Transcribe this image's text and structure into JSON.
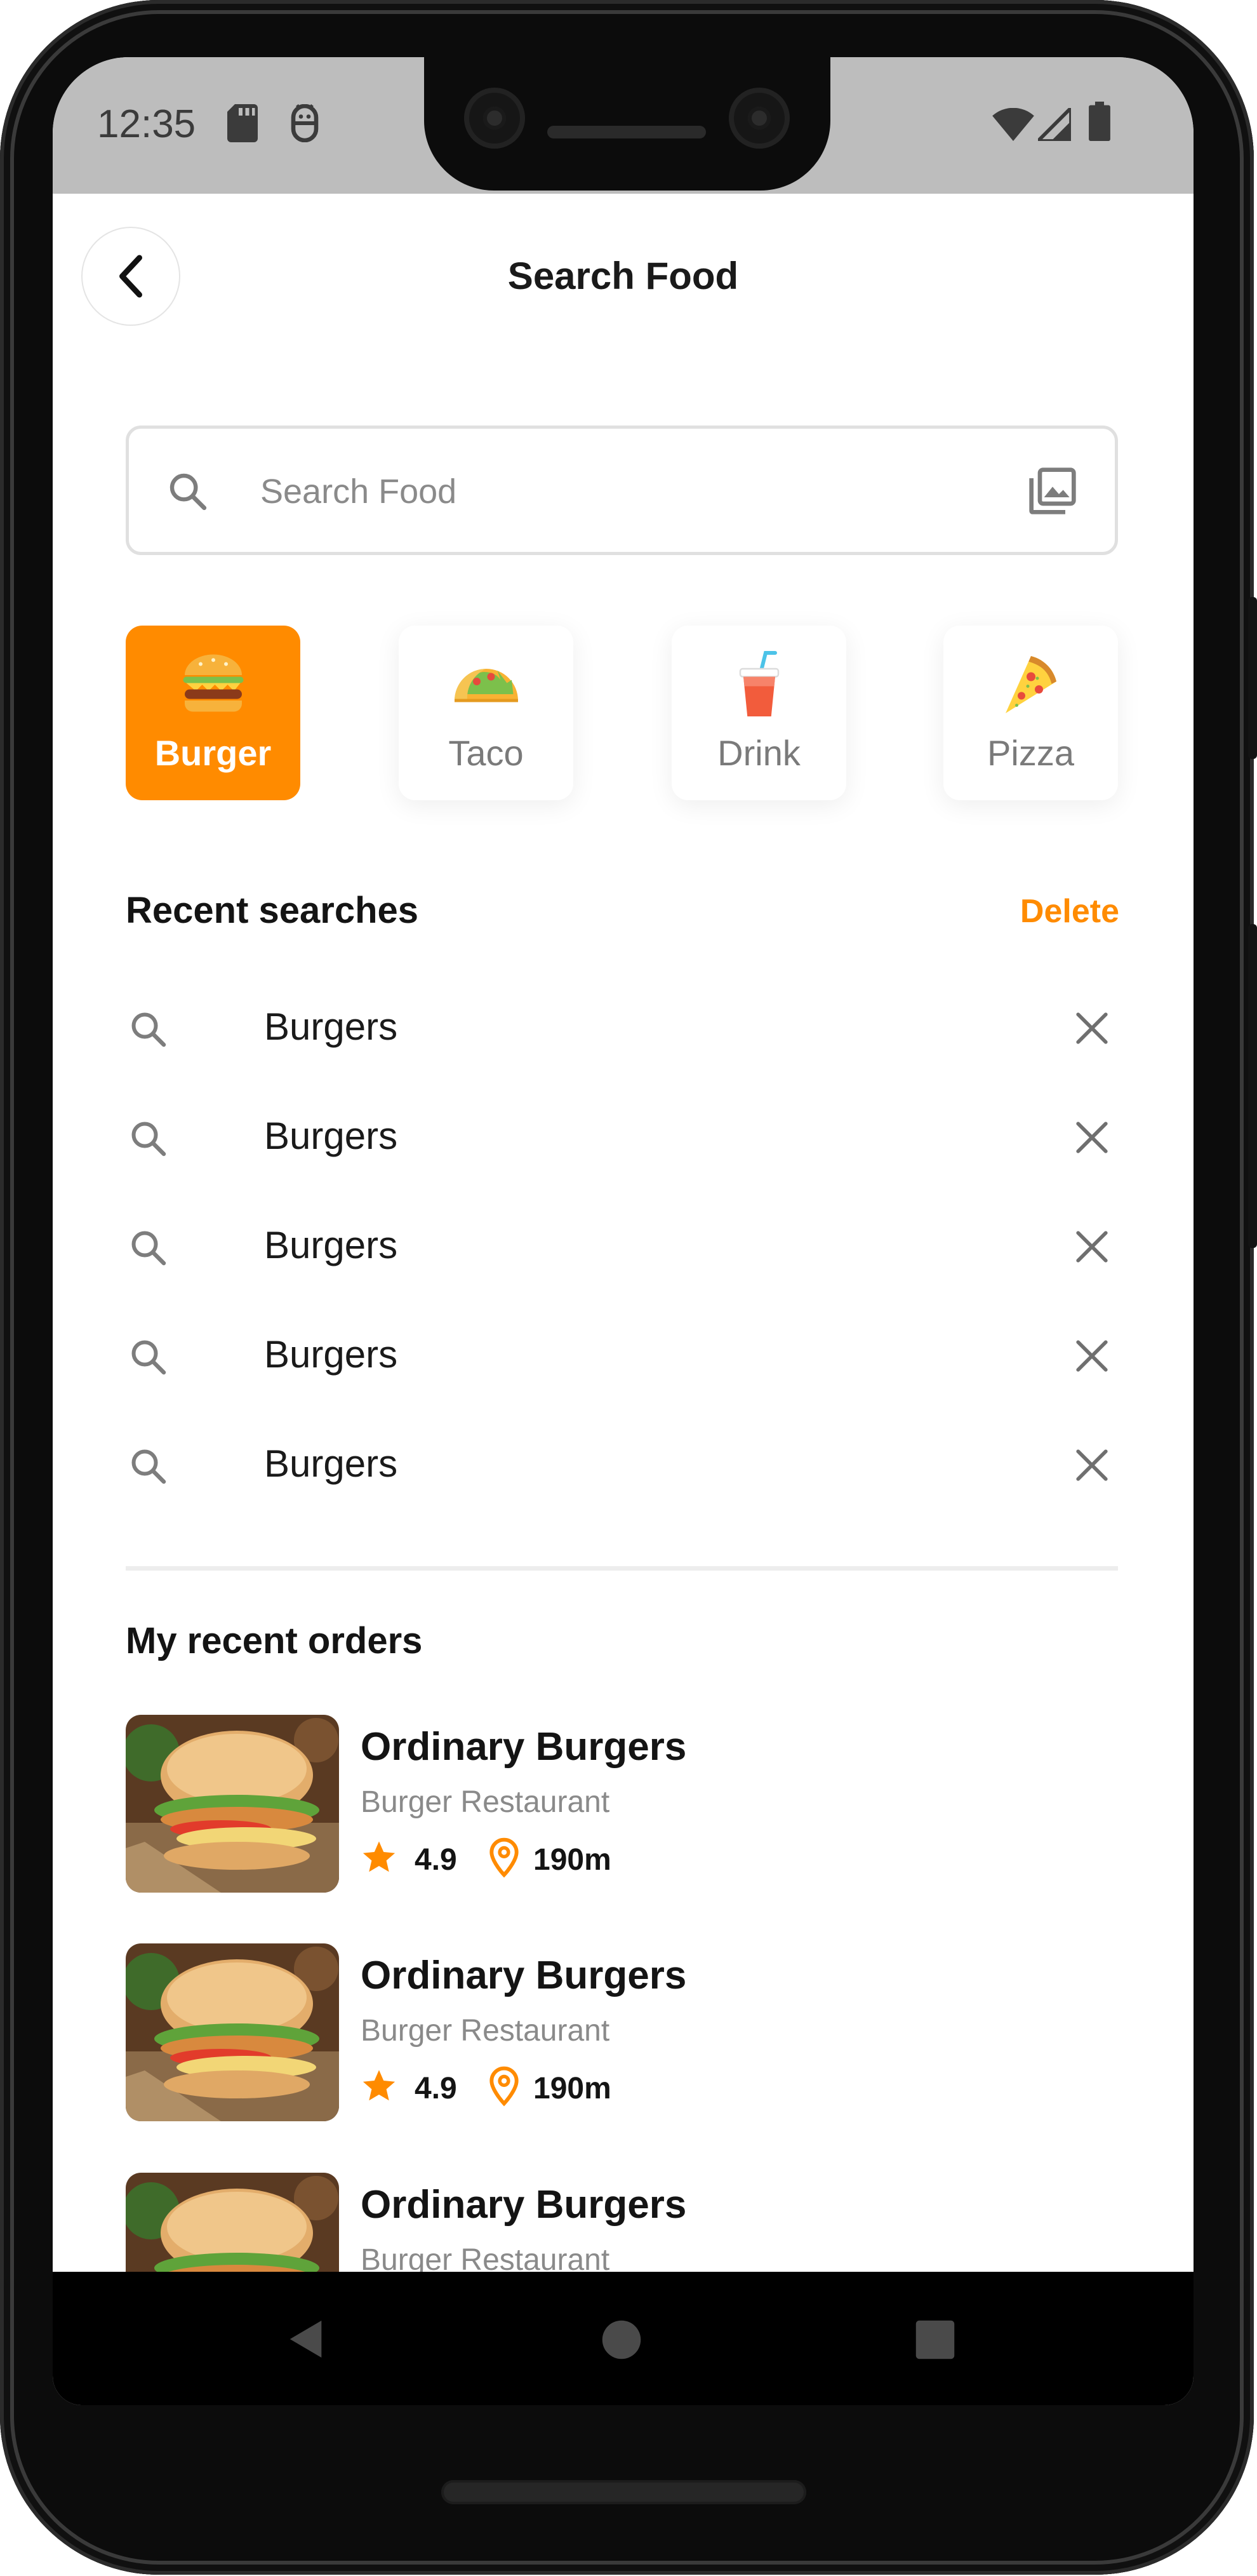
{
  "status_bar": {
    "time": "12:35"
  },
  "header": {
    "title": "Search Food"
  },
  "search": {
    "placeholder": "Search Food",
    "value": ""
  },
  "categories": [
    {
      "label": "Burger",
      "icon": "burger-icon",
      "selected": true
    },
    {
      "label": "Taco",
      "icon": "taco-icon",
      "selected": false
    },
    {
      "label": "Drink",
      "icon": "drink-icon",
      "selected": false
    },
    {
      "label": "Pizza",
      "icon": "pizza-icon",
      "selected": false
    }
  ],
  "recent_searches": {
    "title": "Recent searches",
    "delete_label": "Delete",
    "items": [
      "Burgers",
      "Burgers",
      "Burgers",
      "Burgers",
      "Burgers"
    ]
  },
  "recent_orders": {
    "title": "My recent orders",
    "items": [
      {
        "name": "Ordinary Burgers",
        "category": "Burger Restaurant",
        "rating": "4.9",
        "distance": "190m"
      },
      {
        "name": "Ordinary Burgers",
        "category": "Burger Restaurant",
        "rating": "4.9",
        "distance": "190m"
      },
      {
        "name": "Ordinary Burgers",
        "category": "Burger Restaurant"
      }
    ]
  },
  "colors": {
    "accent": "#FF8B00",
    "text": "#141414",
    "muted": "#8A8A8A",
    "statusbar": "#BDBDBD"
  }
}
